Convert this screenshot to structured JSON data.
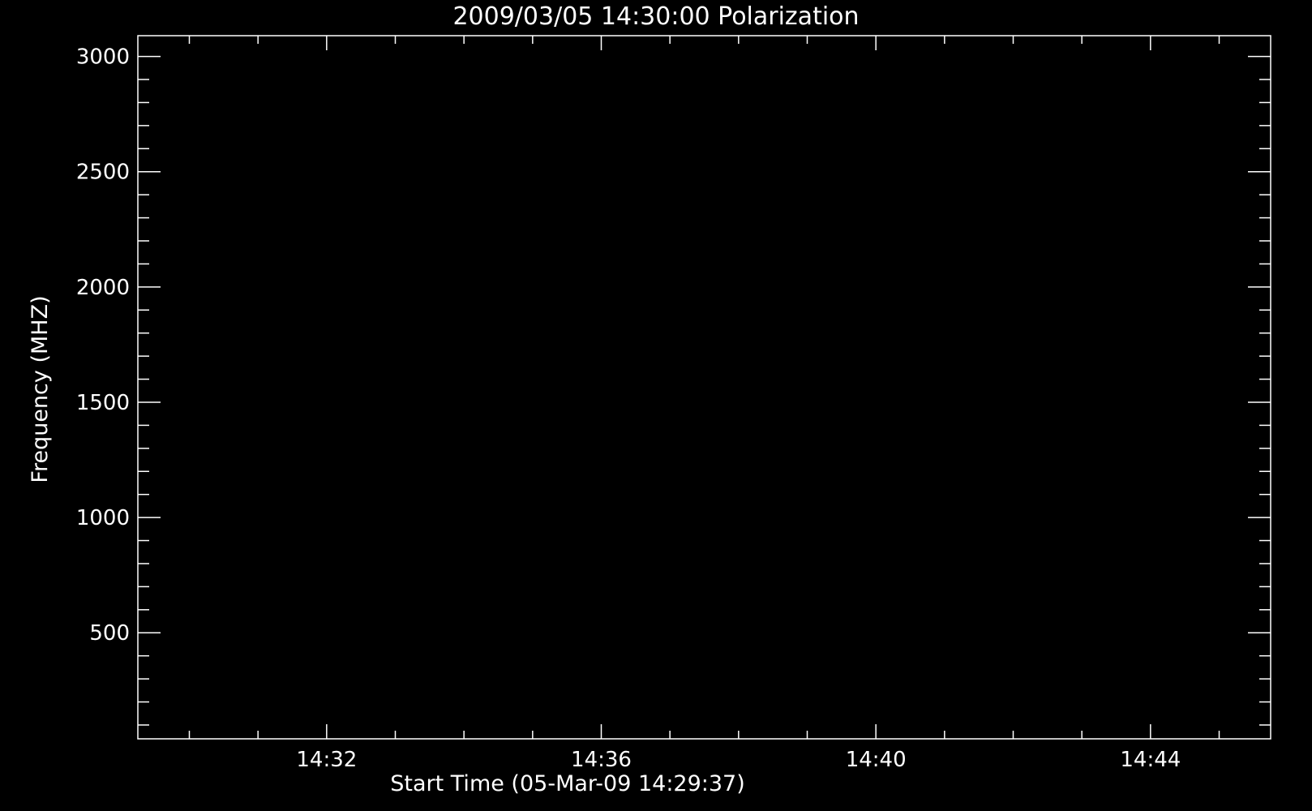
{
  "chart_data": {
    "type": "heatmap",
    "title": "2009/03/05 14:30:00 Polarization",
    "xlabel": "Start Time (05-Mar-09 14:29:37)",
    "ylabel": "Frequency (MHZ)",
    "x_ticks": [
      {
        "label": "14:32",
        "minute": 32
      },
      {
        "label": "14:36",
        "minute": 36
      },
      {
        "label": "14:40",
        "minute": 40
      },
      {
        "label": "14:44",
        "minute": 44
      }
    ],
    "y_ticks": [
      {
        "label": "500",
        "value": 500
      },
      {
        "label": "1000",
        "value": 1000
      },
      {
        "label": "1500",
        "value": 1500
      },
      {
        "label": "2000",
        "value": 2000
      },
      {
        "label": "2500",
        "value": 2500
      },
      {
        "label": "3000",
        "value": 3000
      }
    ],
    "xlim_minutes": [
      29.25,
      45.75
    ],
    "ylim_mhz": [
      3090,
      40
    ],
    "data_x_range_minutes": [
      30,
      45
    ],
    "data_y_range_mhz": [
      110,
      3020
    ],
    "y_inverted": true,
    "colorscale": [
      "#000000",
      "#0000ff",
      "#ff0000",
      "#ffff00"
    ]
  }
}
